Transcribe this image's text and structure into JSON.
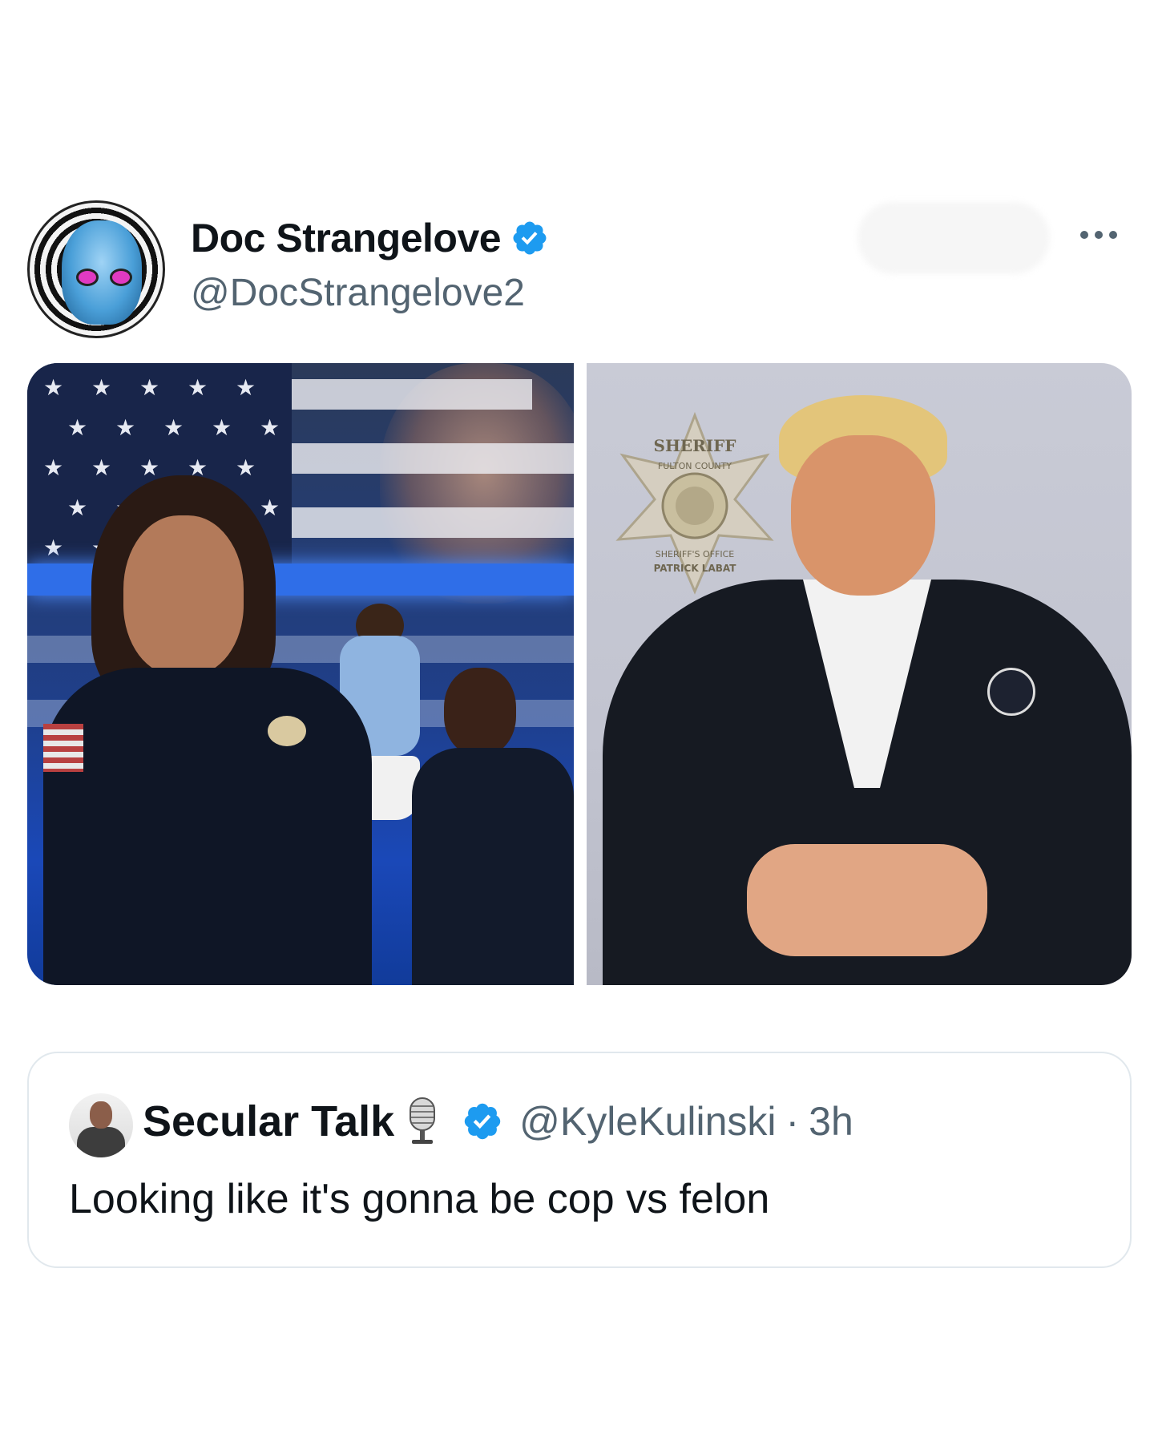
{
  "post": {
    "author": {
      "display_name": "Doc Strangelove",
      "handle": "@DocStrangelove2",
      "verified": true,
      "avatar_icon": "psychedelic-portrait-avatar"
    },
    "actions": {
      "more_icon": "more-horizontal-icon"
    },
    "media": [
      {
        "name": "photo-officer-composite",
        "description_icon": "image"
      },
      {
        "name": "photo-sheriff-mugshot",
        "badge_text_top": "SHERIFF",
        "badge_text_ring": "FULTON COUNTY",
        "badge_text_bottom": "SHERIFF'S OFFICE",
        "badge_text_name": "PATRICK LABAT"
      }
    ]
  },
  "quoted": {
    "author": {
      "display_name": "Secular Talk",
      "handle": "@KyleKulinski",
      "separator": "·",
      "time": "3h",
      "verified": true,
      "emoji_icon": "microphone-icon"
    },
    "text": "Looking like it's gonna be cop vs felon"
  },
  "colors": {
    "verified_blue": "#1d9bf0",
    "text_primary": "#0f1419",
    "text_secondary": "#536471",
    "border": "#e1e8ed"
  }
}
